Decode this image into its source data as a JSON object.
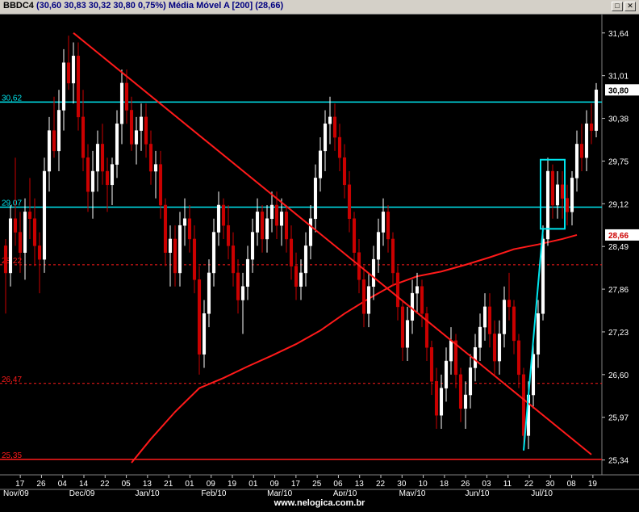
{
  "window": {
    "symbol": "BBDC4",
    "quote": "(30,60  30,83  30,32  30,80  0,75%)",
    "indicator": "Média Móvel A [200]",
    "indicator_value": "(28,66)",
    "colors": {
      "background": "#000000",
      "candle_up": "#ffffff",
      "candle_down": "#cc0000",
      "cyan": "#00e5ee",
      "red": "#ff1a1a"
    }
  },
  "footer": {
    "url": "www.nelogica.com.br"
  },
  "chart_data": {
    "type": "candlestick",
    "y_ticks": [
      "31,64",
      "31,01",
      "30,38",
      "29,75",
      "29,12",
      "28,49",
      "27,86",
      "27,23",
      "26,60",
      "25,97",
      "25,34"
    ],
    "y_tick_values": [
      31.64,
      31.01,
      30.38,
      29.75,
      29.12,
      28.49,
      27.86,
      27.23,
      26.6,
      25.97,
      25.34
    ],
    "ylim": [
      25.24,
      31.84
    ],
    "x_day_labels": [
      "17",
      "26",
      "04",
      "14",
      "22",
      "05",
      "13",
      "21",
      "01",
      "09",
      "19",
      "01",
      "09",
      "17",
      "25",
      "06",
      "13",
      "22",
      "30",
      "10",
      "18",
      "26",
      "03",
      "11",
      "22",
      "30",
      "08",
      "19"
    ],
    "x_month_labels": [
      "Nov/09",
      "Dec/09",
      "Jan/10",
      "Feb/10",
      "Mar/10",
      "Apr/10",
      "May/10",
      "Jun/10",
      "Jul/10"
    ],
    "last_price_label": "30,80",
    "last_price": 30.8,
    "ma_label": "28,66",
    "ma_value": 28.66,
    "horizontal_lines": [
      {
        "label": "30,62",
        "value": 30.62,
        "color": "cyan",
        "style": "solid"
      },
      {
        "label": "29,07",
        "value": 29.07,
        "color": "cyan",
        "style": "solid"
      },
      {
        "label": "28,22",
        "value": 28.22,
        "color": "red",
        "style": "dashed"
      },
      {
        "label": "26,47",
        "value": 26.47,
        "color": "red",
        "style": "dashed"
      },
      {
        "label": "25,35",
        "value": 25.35,
        "color": "red",
        "style": "solid"
      }
    ],
    "trendlines": [
      {
        "color": "red",
        "from": [
          14,
          31.64
        ],
        "to": [
          121,
          25.42
        ]
      },
      {
        "color": "cyan",
        "from": [
          107,
          25.48
        ],
        "to": [
          111,
          28.75
        ]
      }
    ],
    "rectangle": {
      "color": "cyan",
      "x0": 110.5,
      "x1": 115.5,
      "y_low": 28.75,
      "y_high": 29.77
    },
    "moving_average_200": [
      [
        26,
        25.3
      ],
      [
        30,
        25.65
      ],
      [
        35,
        26.05
      ],
      [
        40,
        26.4
      ],
      [
        45,
        26.55
      ],
      [
        50,
        26.72
      ],
      [
        55,
        26.88
      ],
      [
        60,
        27.05
      ],
      [
        65,
        27.25
      ],
      [
        70,
        27.5
      ],
      [
        75,
        27.72
      ],
      [
        80,
        27.92
      ],
      [
        85,
        28.05
      ],
      [
        90,
        28.12
      ],
      [
        95,
        28.22
      ],
      [
        100,
        28.33
      ],
      [
        105,
        28.45
      ],
      [
        110,
        28.52
      ],
      [
        115,
        28.6
      ],
      [
        118,
        28.66
      ]
    ],
    "candles": [
      [
        28.5,
        28.6,
        27.5,
        28.1
      ],
      [
        28.1,
        29.1,
        27.9,
        28.9
      ],
      [
        28.9,
        29.8,
        28.5,
        28.7
      ],
      [
        28.7,
        29.0,
        28.1,
        28.4
      ],
      [
        28.4,
        29.2,
        28.0,
        29.0
      ],
      [
        29.0,
        29.5,
        28.6,
        28.9
      ],
      [
        28.9,
        29.2,
        28.2,
        28.5
      ],
      [
        28.5,
        28.7,
        27.8,
        28.3
      ],
      [
        28.3,
        29.8,
        28.1,
        29.6
      ],
      [
        29.6,
        30.4,
        29.3,
        30.2
      ],
      [
        30.2,
        30.7,
        29.8,
        29.9
      ],
      [
        29.9,
        30.8,
        29.6,
        30.5
      ],
      [
        30.5,
        31.4,
        30.2,
        31.2
      ],
      [
        31.2,
        31.6,
        30.8,
        30.9
      ],
      [
        30.9,
        31.5,
        30.6,
        31.3
      ],
      [
        31.3,
        31.5,
        30.2,
        30.4
      ],
      [
        30.4,
        30.8,
        29.6,
        29.8
      ],
      [
        29.8,
        30.0,
        29.0,
        29.3
      ],
      [
        29.3,
        29.9,
        28.9,
        29.6
      ],
      [
        29.6,
        30.2,
        29.3,
        30.0
      ],
      [
        30.0,
        30.3,
        29.4,
        29.6
      ],
      [
        29.6,
        29.8,
        29.0,
        29.4
      ],
      [
        29.4,
        29.8,
        29.1,
        29.7
      ],
      [
        29.7,
        30.5,
        29.5,
        30.3
      ],
      [
        30.3,
        31.1,
        30.0,
        30.9
      ],
      [
        30.9,
        31.1,
        30.3,
        30.5
      ],
      [
        30.5,
        30.7,
        29.9,
        30.0
      ],
      [
        30.0,
        30.4,
        29.7,
        30.2
      ],
      [
        30.2,
        30.6,
        29.9,
        30.4
      ],
      [
        30.4,
        30.6,
        29.8,
        30.0
      ],
      [
        30.0,
        30.2,
        29.4,
        29.6
      ],
      [
        29.6,
        29.9,
        29.2,
        29.7
      ],
      [
        29.7,
        29.9,
        28.9,
        29.1
      ],
      [
        29.1,
        29.2,
        28.2,
        28.4
      ],
      [
        28.4,
        28.8,
        27.9,
        28.6
      ],
      [
        28.6,
        28.8,
        27.9,
        28.1
      ],
      [
        28.1,
        29.0,
        27.9,
        28.8
      ],
      [
        28.8,
        29.2,
        28.5,
        28.9
      ],
      [
        28.9,
        29.1,
        28.4,
        28.6
      ],
      [
        28.6,
        28.8,
        27.8,
        28.0
      ],
      [
        28.0,
        28.2,
        26.6,
        26.9
      ],
      [
        26.9,
        27.7,
        26.7,
        27.5
      ],
      [
        27.5,
        28.3,
        27.3,
        28.1
      ],
      [
        28.1,
        28.9,
        27.9,
        28.7
      ],
      [
        28.7,
        29.3,
        28.5,
        29.1
      ],
      [
        29.1,
        29.2,
        28.6,
        28.8
      ],
      [
        28.8,
        29.1,
        28.3,
        28.5
      ],
      [
        28.5,
        28.7,
        27.9,
        28.1
      ],
      [
        28.1,
        28.3,
        27.5,
        27.7
      ],
      [
        27.7,
        28.1,
        27.2,
        27.9
      ],
      [
        27.9,
        28.5,
        27.7,
        28.3
      ],
      [
        28.3,
        28.9,
        28.1,
        28.7
      ],
      [
        28.7,
        29.2,
        28.5,
        29.0
      ],
      [
        29.0,
        29.1,
        28.4,
        28.6
      ],
      [
        28.6,
        29.1,
        28.4,
        28.9
      ],
      [
        28.9,
        29.3,
        28.7,
        29.1
      ],
      [
        29.1,
        29.3,
        28.6,
        28.8
      ],
      [
        28.8,
        29.2,
        28.5,
        29.0
      ],
      [
        29.0,
        29.1,
        28.4,
        28.6
      ],
      [
        28.6,
        28.8,
        28.0,
        28.2
      ],
      [
        28.2,
        28.4,
        27.7,
        27.9
      ],
      [
        27.9,
        28.3,
        27.7,
        28.1
      ],
      [
        28.1,
        28.7,
        27.9,
        28.5
      ],
      [
        28.5,
        29.1,
        28.3,
        28.9
      ],
      [
        28.9,
        29.7,
        28.7,
        29.5
      ],
      [
        29.5,
        30.1,
        29.3,
        29.9
      ],
      [
        29.9,
        30.5,
        29.6,
        30.3
      ],
      [
        30.3,
        30.7,
        30.0,
        30.4
      ],
      [
        30.4,
        30.6,
        29.9,
        30.1
      ],
      [
        30.1,
        30.3,
        29.6,
        29.8
      ],
      [
        29.8,
        30.0,
        29.2,
        29.4
      ],
      [
        29.4,
        29.6,
        28.7,
        28.9
      ],
      [
        28.9,
        29.0,
        28.2,
        28.4
      ],
      [
        28.4,
        28.6,
        27.8,
        28.0
      ],
      [
        28.0,
        28.2,
        27.3,
        27.5
      ],
      [
        27.5,
        28.1,
        27.3,
        27.9
      ],
      [
        27.9,
        28.5,
        27.7,
        28.3
      ],
      [
        28.3,
        28.9,
        28.1,
        28.7
      ],
      [
        28.7,
        29.2,
        28.5,
        29.0
      ],
      [
        29.0,
        29.1,
        28.4,
        28.6
      ],
      [
        28.6,
        28.7,
        27.9,
        28.1
      ],
      [
        28.1,
        28.2,
        27.4,
        27.6
      ],
      [
        27.6,
        27.7,
        26.8,
        27.0
      ],
      [
        27.0,
        27.6,
        26.8,
        27.4
      ],
      [
        27.4,
        28.0,
        27.2,
        27.8
      ],
      [
        27.8,
        28.1,
        27.5,
        27.9
      ],
      [
        27.9,
        28.0,
        27.3,
        27.5
      ],
      [
        27.5,
        27.6,
        26.8,
        27.0
      ],
      [
        27.0,
        27.1,
        26.3,
        26.5
      ],
      [
        26.5,
        26.7,
        25.8,
        26.0
      ],
      [
        26.0,
        26.6,
        25.8,
        26.4
      ],
      [
        26.4,
        27.0,
        26.2,
        26.8
      ],
      [
        26.8,
        27.3,
        26.6,
        27.1
      ],
      [
        27.1,
        27.2,
        26.4,
        26.6
      ],
      [
        26.6,
        26.7,
        25.9,
        26.1
      ],
      [
        26.1,
        26.5,
        25.8,
        26.3
      ],
      [
        26.3,
        26.9,
        26.1,
        26.7
      ],
      [
        26.7,
        27.2,
        26.5,
        27.0
      ],
      [
        27.0,
        27.5,
        26.8,
        27.3
      ],
      [
        27.3,
        27.8,
        27.1,
        27.6
      ],
      [
        27.6,
        27.8,
        27.0,
        27.2
      ],
      [
        27.2,
        27.4,
        26.6,
        26.8
      ],
      [
        26.8,
        27.4,
        26.6,
        27.2
      ],
      [
        27.2,
        27.9,
        27.0,
        27.7
      ],
      [
        27.7,
        28.1,
        27.4,
        27.6
      ],
      [
        27.6,
        27.7,
        26.9,
        27.1
      ],
      [
        27.1,
        27.2,
        26.4,
        26.6
      ],
      [
        26.6,
        26.7,
        25.5,
        25.7
      ],
      [
        25.7,
        26.5,
        25.5,
        26.3
      ],
      [
        26.3,
        27.1,
        26.1,
        26.9
      ],
      [
        26.9,
        27.7,
        26.7,
        27.5
      ],
      [
        27.5,
        28.8,
        27.4,
        28.6
      ],
      [
        28.6,
        29.8,
        28.5,
        29.6
      ],
      [
        29.6,
        29.7,
        28.9,
        29.1
      ],
      [
        29.1,
        29.6,
        28.9,
        29.4
      ],
      [
        29.4,
        29.6,
        28.9,
        29.2
      ],
      [
        29.2,
        29.4,
        28.8,
        29.0
      ],
      [
        29.0,
        29.6,
        28.8,
        29.5
      ],
      [
        29.5,
        30.2,
        29.3,
        30.0
      ],
      [
        30.0,
        30.3,
        29.6,
        29.8
      ],
      [
        29.8,
        30.5,
        29.6,
        30.3
      ],
      [
        30.3,
        30.6,
        30.0,
        30.2
      ],
      [
        30.2,
        30.9,
        30.1,
        30.8
      ]
    ]
  }
}
